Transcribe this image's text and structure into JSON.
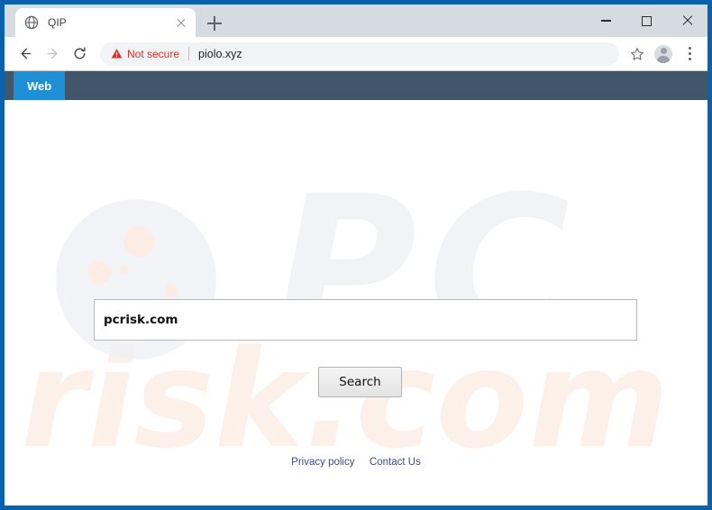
{
  "browser": {
    "tab": {
      "title": "QIP",
      "favicon": "globe-icon",
      "close_icon": "close-icon"
    },
    "new_tab_icon": "plus-icon",
    "window_controls": {
      "minimize": "minimize-icon",
      "maximize": "maximize-icon",
      "close": "close-icon"
    },
    "toolbar": {
      "back_icon": "back-arrow-icon",
      "forward_icon": "forward-arrow-icon",
      "reload_icon": "reload-icon",
      "security_warning_icon": "warning-triangle-icon",
      "security_label": "Not secure",
      "security_color": "#d93025",
      "url": "piolo.xyz",
      "bookmark_icon": "star-icon",
      "profile_icon": "avatar-icon",
      "menu_icon": "three-dots-menu-icon"
    }
  },
  "site": {
    "nav": {
      "active_tab": "Web",
      "active_tab_color": "#1e8fd5",
      "bar_color": "#42566a"
    },
    "search": {
      "value": "pcrisk.com",
      "placeholder": "",
      "button_label": "Search"
    },
    "footer": {
      "links": [
        {
          "label": "Privacy policy"
        },
        {
          "label": "Contact Us"
        }
      ],
      "link_color": "#3d4a8a"
    },
    "watermark": {
      "top_text": "PC",
      "bottom_text": "risk.com",
      "top_color": "#f2f3f4",
      "bottom_color": "#fdf0e9"
    }
  },
  "frame": {
    "border_color": "#0b61ab"
  }
}
